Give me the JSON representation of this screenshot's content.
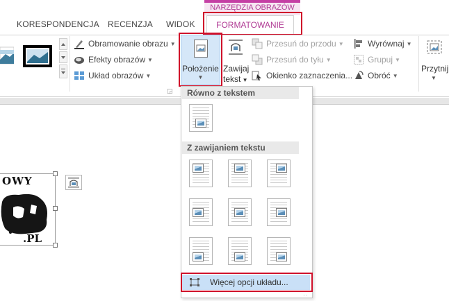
{
  "tabs": [
    {
      "label": "KORESPONDENCJA"
    },
    {
      "label": "RECENZJA"
    },
    {
      "label": "WIDOK"
    }
  ],
  "context": {
    "group_label": "NARZĘDZIA OBRAZÓW",
    "active_tab": "FORMATOWANIE",
    "accent_color": "#b03a94"
  },
  "ribbon": {
    "picture_border": "Obramowanie obrazu",
    "picture_effects": "Efekty obrazów",
    "picture_layout": "Układ obrazów",
    "position": "Położenie",
    "wrap_text_line1": "Zawijaj",
    "wrap_text_line2": "tekst",
    "bring_forward": "Przesuń do przodu",
    "send_backward": "Przesuń do tyłu",
    "selection_pane": "Okienko zaznaczenia...",
    "align": "Wyrównaj",
    "group": "Grupuj",
    "rotate": "Obróć",
    "crop": "Przytnij"
  },
  "dropdown": {
    "section_inline": "Równo z tekstem",
    "section_wrap": "Z zawijaniem tekstu",
    "more_options": "Więcej opcji układu...",
    "highlight_color": "#c9e0f7"
  },
  "document": {
    "image_text_top": "OWY",
    "image_text_bottom": ".PL"
  },
  "annotation_color": "#d0112b"
}
